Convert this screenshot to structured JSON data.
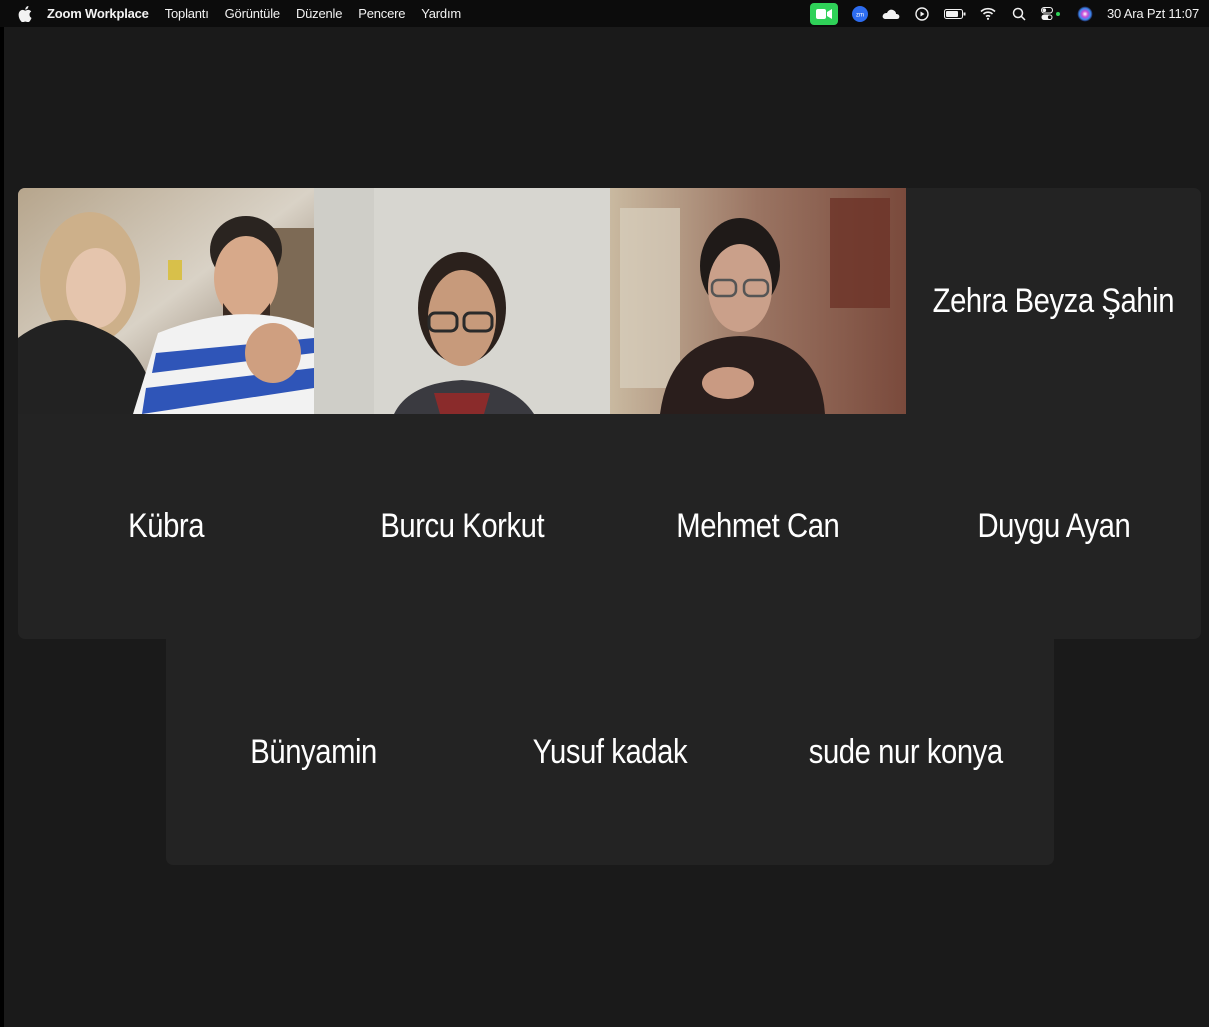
{
  "menubar": {
    "app_name": "Zoom Workplace",
    "menus": [
      "Toplantı",
      "Görüntüle",
      "Düzenle",
      "Pencere",
      "Yardım"
    ],
    "clock": "30 Ara Pzt  11:07",
    "icons": [
      "apple-icon",
      "zoom-meeting-icon",
      "zoom-app-icon",
      "cloud-icon",
      "play-icon",
      "battery-icon",
      "wifi-icon",
      "search-icon",
      "control-center-icon",
      "siri-icon"
    ]
  },
  "meeting": {
    "active_speaker_color": "#34c759",
    "tile_bg": "#232323",
    "tiles_row1": [
      {
        "name": "Kübra",
        "video": true
      },
      {
        "name": "Burcu Korkut",
        "video": true
      },
      {
        "name": "Mehmet Can",
        "video": true,
        "active": true
      },
      {
        "name": "Zehra Beyza Şahin",
        "video": false
      }
    ],
    "tiles_row2": [
      {
        "name": "Kübra"
      },
      {
        "name": "Burcu Korkut"
      },
      {
        "name": "Mehmet Can"
      },
      {
        "name": "Duygu Ayan"
      }
    ],
    "tiles_row3": [
      {
        "name": "Bünyamin"
      },
      {
        "name": "Yusuf kadak"
      },
      {
        "name": "sude nur konya"
      }
    ]
  }
}
